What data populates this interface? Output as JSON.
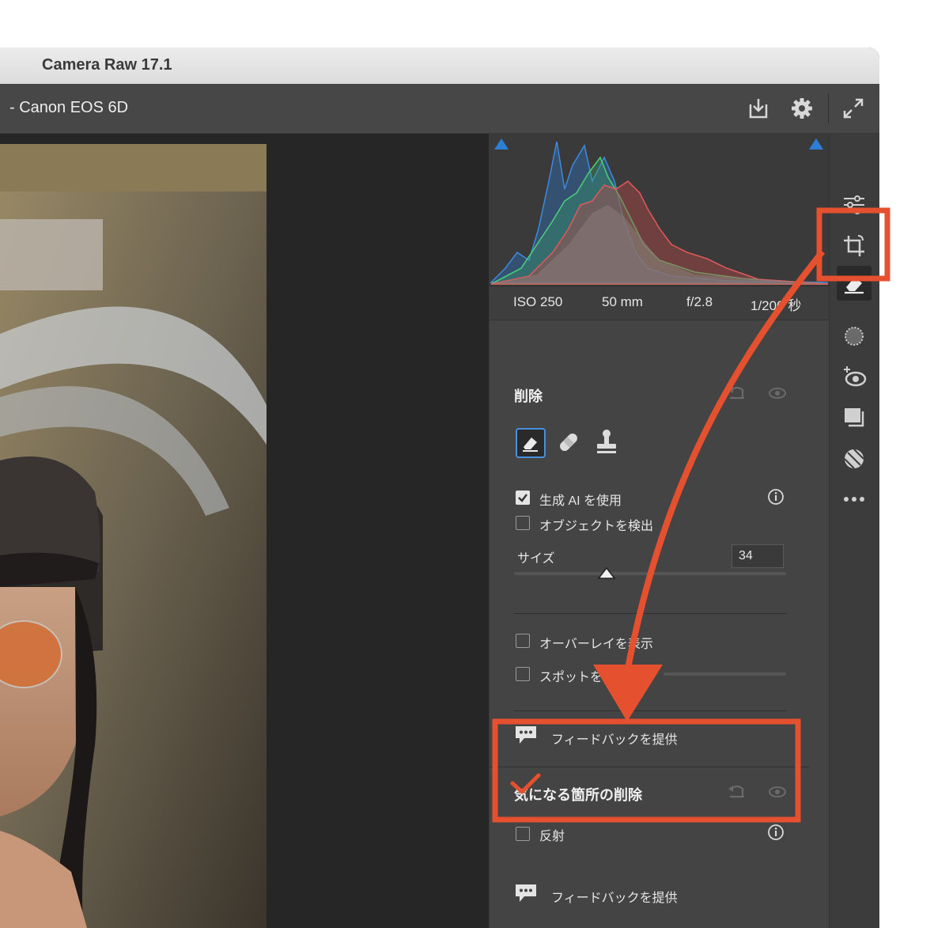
{
  "window": {
    "title": "Camera Raw 17.1"
  },
  "header": {
    "camera": "-  Canon EOS 6D"
  },
  "exif": {
    "iso": "ISO 250",
    "focal": "50 mm",
    "aperture": "f/2.8",
    "shutter": "1/200 秒"
  },
  "remove_panel": {
    "title": "削除",
    "use_generative_ai": "生成 AI を使用",
    "detect_objects": "オブジェクトを検出",
    "size_label": "サイズ",
    "size_value": "34",
    "size_fraction": 0.34,
    "show_overlay": "オーバーレイを表示",
    "visualize_spots": "スポットを可視化",
    "feedback": "フィードバックを提供"
  },
  "distraction_panel": {
    "title": "気になる箇所の削除",
    "reflections": "反射",
    "feedback": "フィードバックを提供"
  },
  "colors": {
    "accent": "#e5502f",
    "selected_tool": "#4a90e2"
  }
}
